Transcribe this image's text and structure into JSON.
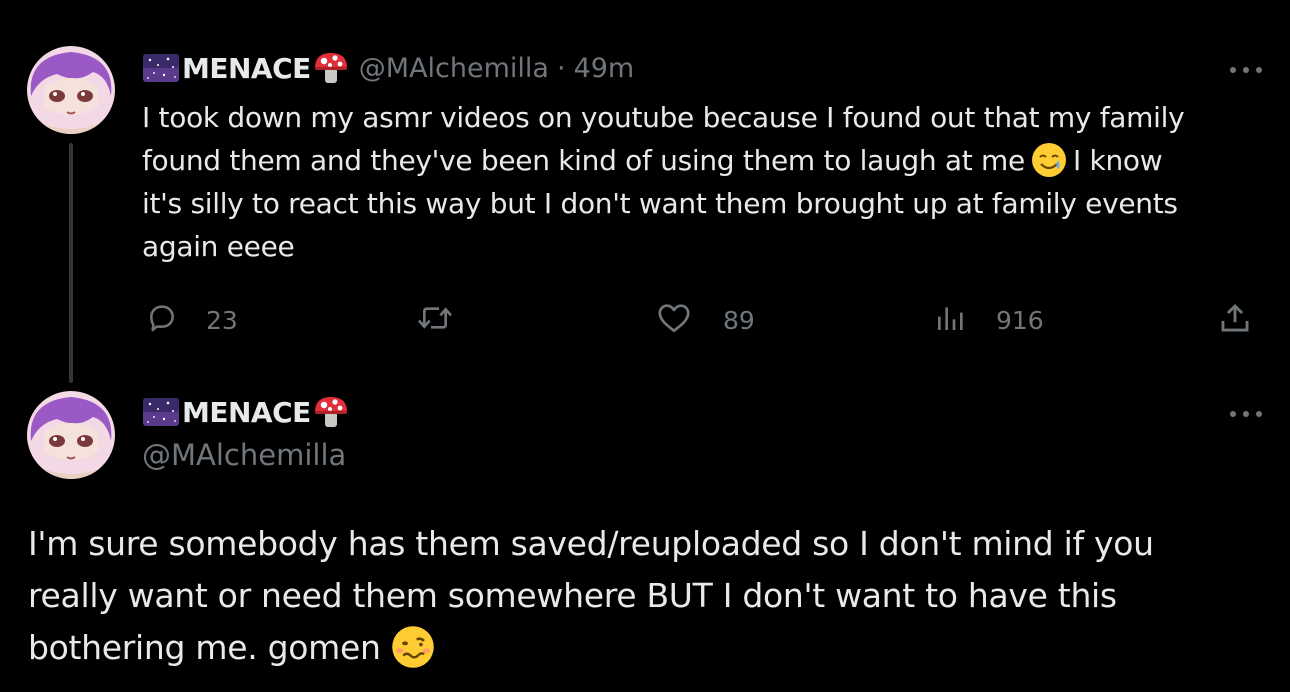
{
  "colors": {
    "background": "#000000",
    "text_primary": "#e7e9ea",
    "text_secondary": "#71767b",
    "thread_line": "#333639"
  },
  "tweet1": {
    "author": {
      "display_name": "MENACE",
      "handle": "@MAlchemilla",
      "name_prefix_emoji": "night-with-stars-emoji",
      "name_suffix_emoji": "mushroom-emoji"
    },
    "separator": "·",
    "timestamp": "49m",
    "text_lines": [
      "I took down my asmr videos on youtube because I found out that my family",
      "found them and they've been kind of using them to laugh at me",
      "I know",
      "it's silly to react this way but I don't want them brought up at family events",
      "again eeee"
    ],
    "inline_emoji": "smiling-face-with-tear-emoji",
    "actions": {
      "reply_count": "23",
      "retweet_count": "",
      "like_count": "89",
      "views_count": "916"
    }
  },
  "tweet2": {
    "author": {
      "display_name": "MENACE",
      "handle": "@MAlchemilla",
      "name_prefix_emoji": "night-with-stars-emoji",
      "name_suffix_emoji": "mushroom-emoji"
    },
    "text_lines": [
      "I'm sure somebody has them saved/reuploaded so I don't mind if you",
      "really want or need them somewhere BUT I don't want to have this",
      "bothering me. gomen"
    ],
    "inline_emoji": "woozy-face-emoji"
  }
}
